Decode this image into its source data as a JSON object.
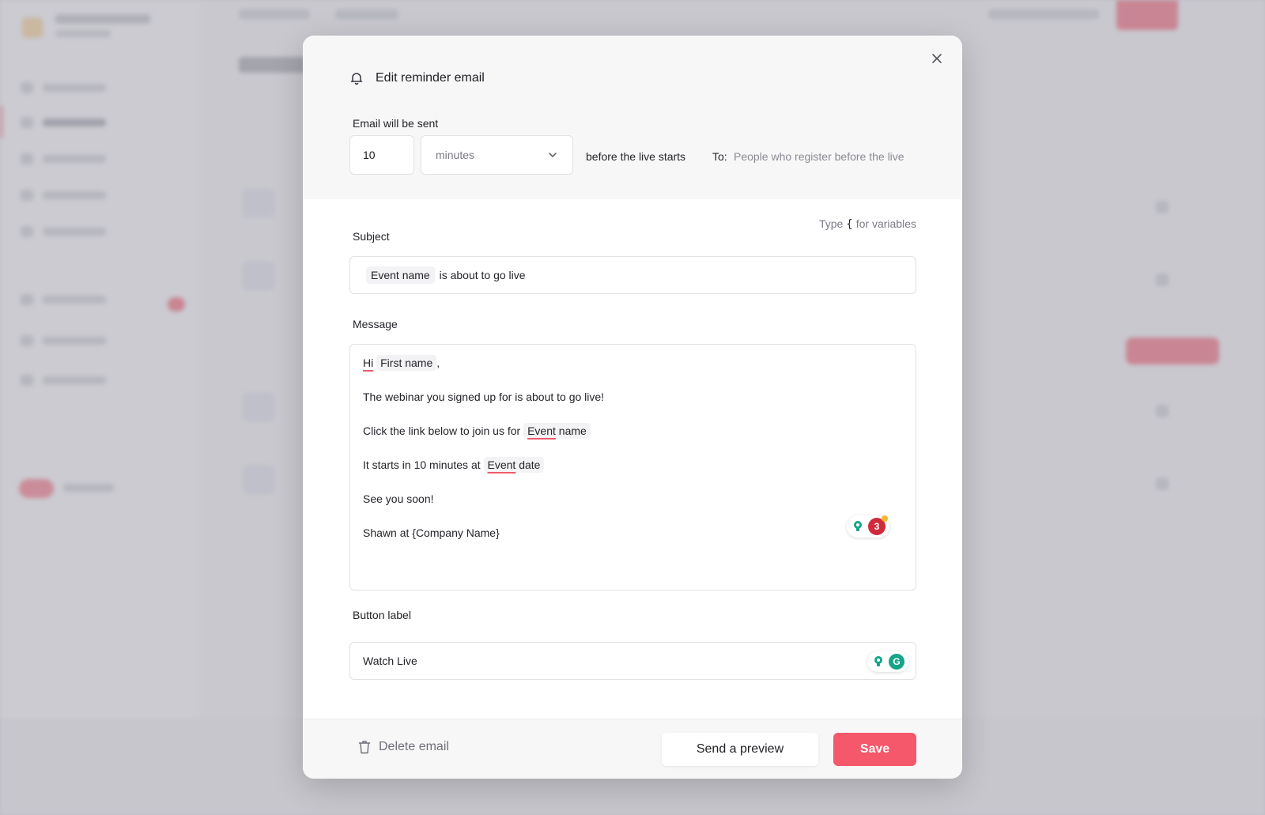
{
  "modal": {
    "title": "Edit reminder email",
    "icons": {
      "title": "bell-icon",
      "close": "close-icon"
    }
  },
  "schedule": {
    "label": "Email will be sent",
    "amount": "10",
    "unit": "minutes",
    "relative_text": "before the live starts",
    "to_label": "To:",
    "to_value": "People who register before the live"
  },
  "variables_hint": {
    "prefix": "Type",
    "symbol": "{",
    "suffix": "for variables"
  },
  "subject": {
    "label": "Subject",
    "variable": "Event name",
    "text": "is about to go live"
  },
  "message": {
    "label": "Message",
    "greeting": "Hi",
    "greeting_variable": "First name",
    "greeting_end": ",",
    "line2": "The webinar you signed up for is about to go live!",
    "line3_text": "Click the link below to join us for",
    "line3_var_a": "Event",
    "line3_var_b": "name",
    "line4_text": "It starts in 10 minutes at",
    "line4_var_a": "Event",
    "line4_var_b": "date",
    "line5": "See you soon!",
    "line6": "Shawn at {Company Name}",
    "grammarly_count": "3"
  },
  "button_label": {
    "label": "Button label",
    "value": "Watch Live",
    "grammarly_logo": "G"
  },
  "footer": {
    "delete_label": "Delete email",
    "preview_label": "Send a preview",
    "save_label": "Save"
  },
  "colors": {
    "accent": "#f5576b",
    "grammarly_green": "#15a589",
    "grammarly_red": "#d02a3b"
  }
}
